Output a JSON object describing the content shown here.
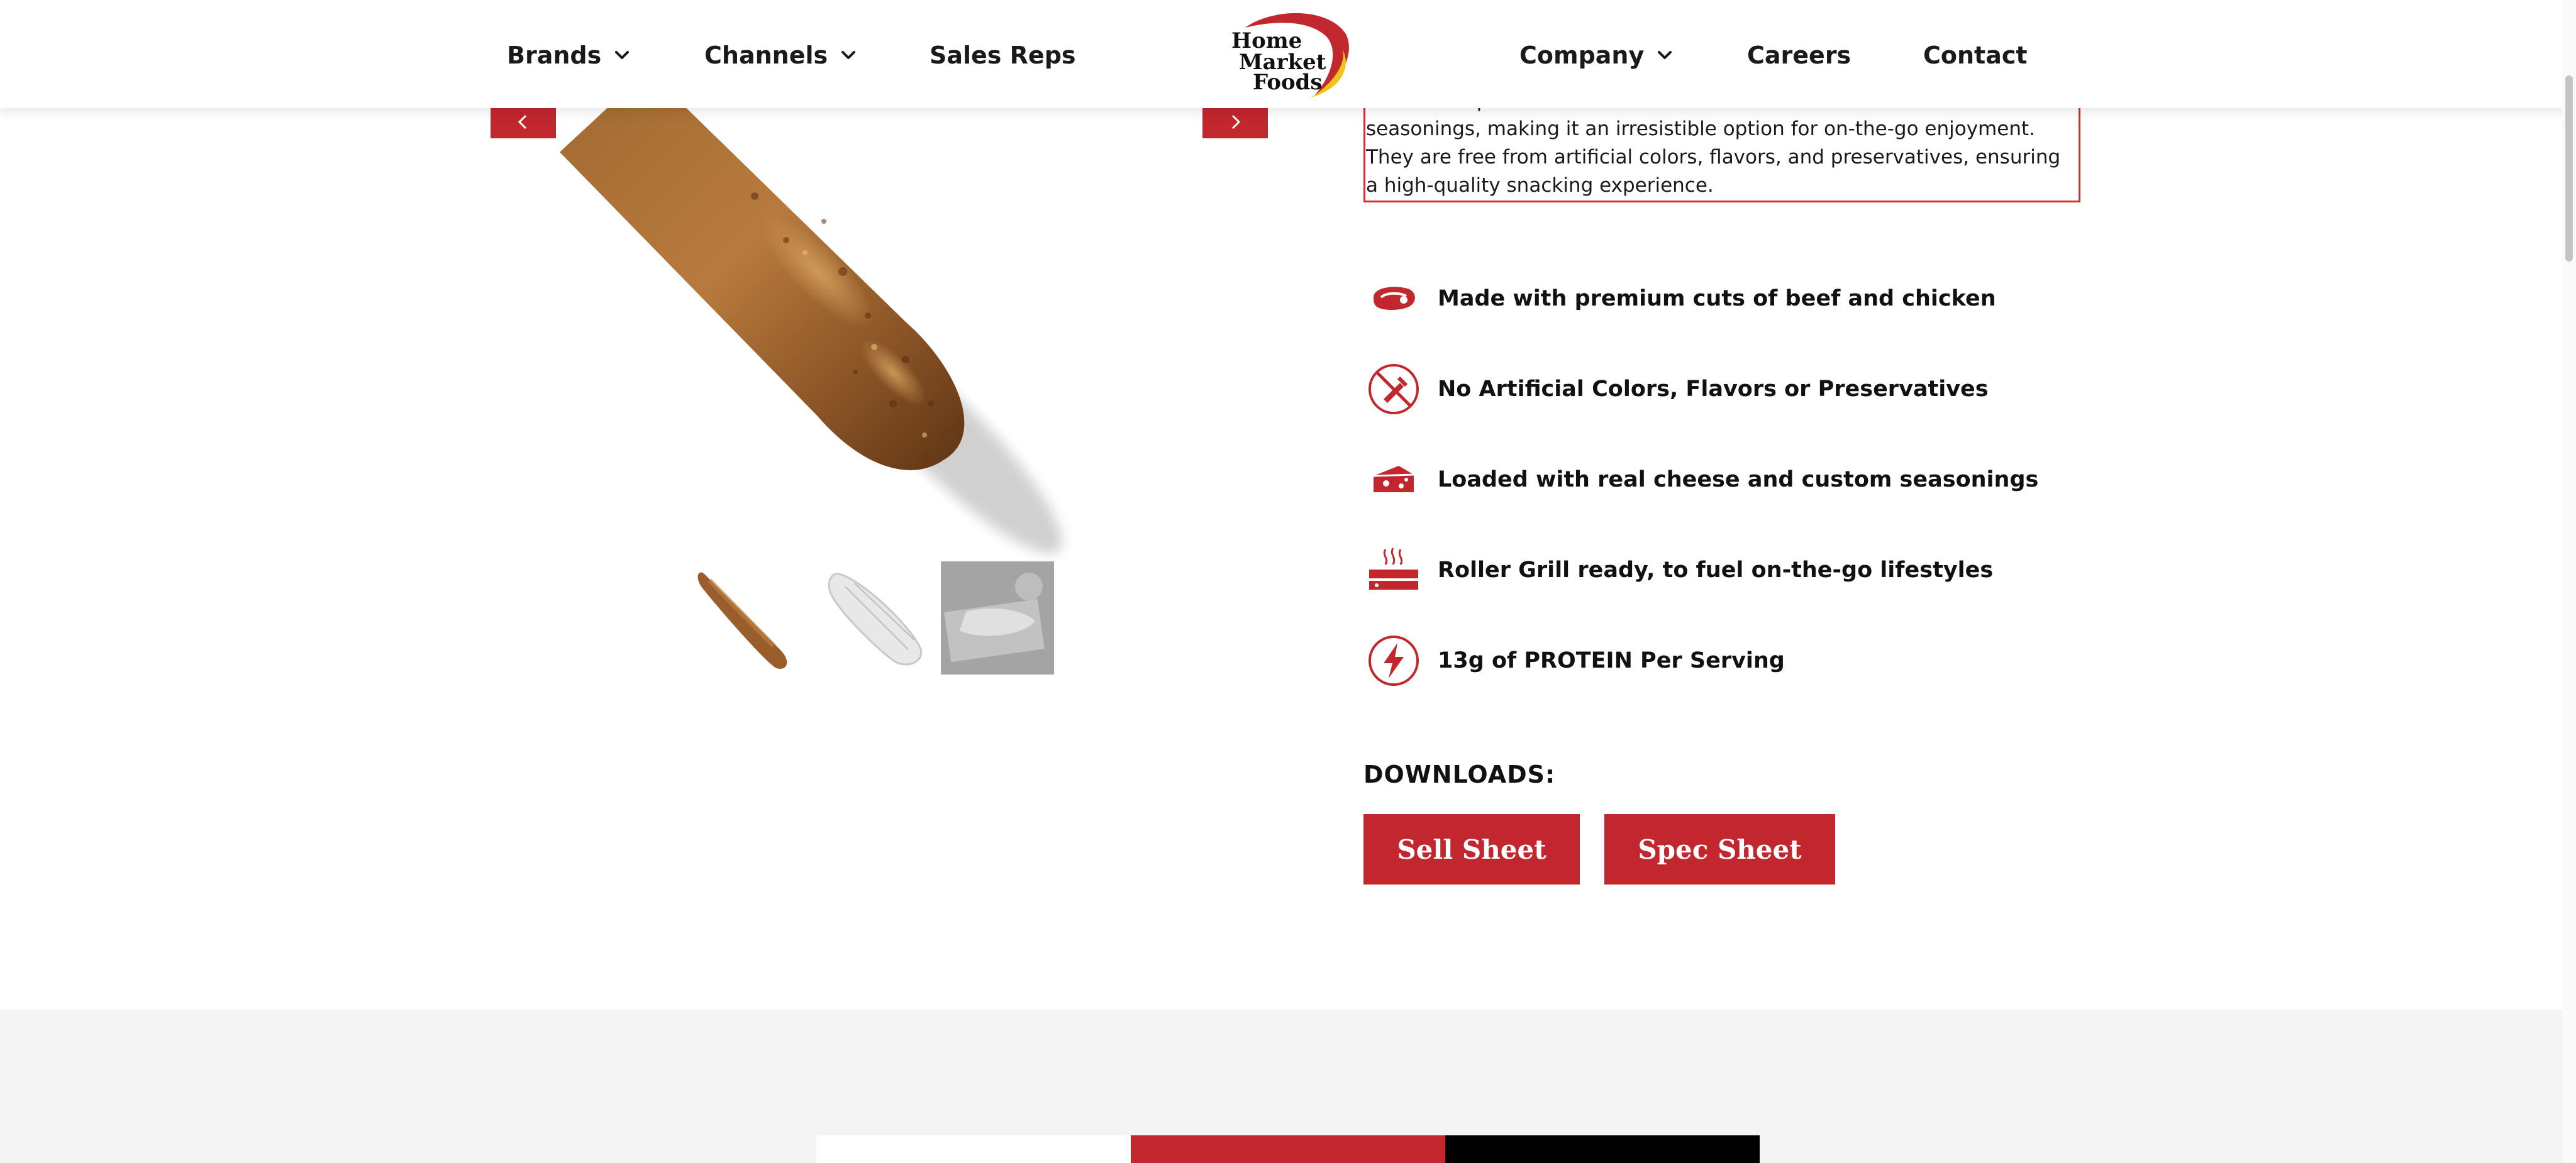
{
  "nav": {
    "brands": "Brands",
    "channels": "Channels",
    "sales_reps": "Sales Reps",
    "company": "Company",
    "careers": "Careers",
    "contact": "Contact",
    "logo_text": [
      "Home",
      "Market",
      "Foods"
    ]
  },
  "product": {
    "description": "... blend of premium beef and chicken with real cheese and custom seasonings, making it an irresistible option for on-the-go enjoyment. They are free from artificial colors, flavors, and preservatives, ensuring a high-quality snacking experience.",
    "thumbnails": [
      "thumb-grilled",
      "thumb-wrapped",
      "thumb-packaged"
    ]
  },
  "features": [
    {
      "icon": "steak-icon",
      "label": "Made with premium cuts of beef and chicken"
    },
    {
      "icon": "no-additives-icon",
      "label": "No Artificial Colors, Flavors or Preservatives"
    },
    {
      "icon": "cheese-icon",
      "label": "Loaded with real cheese and custom seasonings"
    },
    {
      "icon": "roller-grill-icon",
      "label": "Roller Grill ready, to fuel on-the-go lifestyles"
    },
    {
      "icon": "lightning-icon",
      "label": "13g of PROTEIN Per Serving"
    }
  ],
  "downloads": {
    "title": "DOWNLOADS:",
    "sell_sheet": "Sell Sheet",
    "spec_sheet": "Spec Sheet"
  },
  "colors": {
    "brand_red": "#c1272d",
    "border_red": "#d32f2f",
    "logo_gold": "#f2c318",
    "band_grey": "#f4f4f4"
  }
}
